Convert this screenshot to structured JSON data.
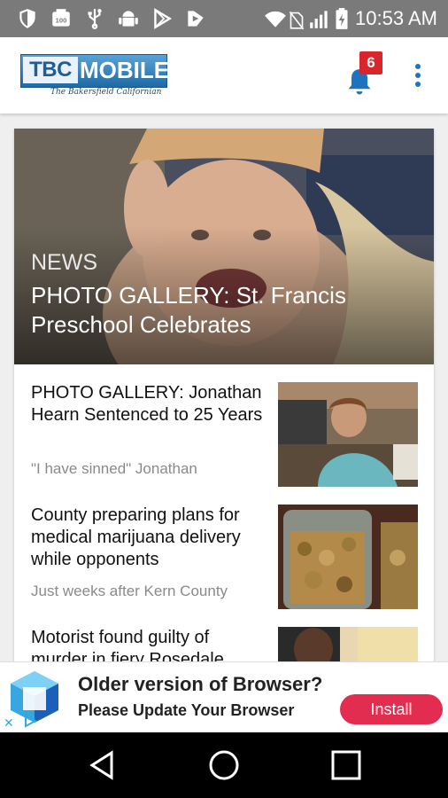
{
  "status_bar": {
    "time": "10:53 AM",
    "icons": [
      "shield-icon",
      "news-100-icon",
      "usb-icon",
      "android-icon",
      "play-store-icon",
      "play-movies-icon",
      "wifi-icon",
      "no-sim-icon",
      "signal-icon",
      "battery-icon"
    ]
  },
  "header": {
    "logo_tbc": "TBC",
    "logo_mobile": "MOBILE",
    "logo_subtitle": "The Bakersfield Californian",
    "notification_count": "6"
  },
  "hero": {
    "category": "NEWS",
    "title": "PHOTO GALLERY: St. Francis Preschool Celebrates"
  },
  "articles": [
    {
      "title": "PHOTO GALLERY: Jonathan Hearn Sentenced to 25 Years",
      "snippet": "\"I have sinned\" Jonathan"
    },
    {
      "title": "County preparing plans for medical marijuana delivery while opponents",
      "snippet": "Just weeks after Kern County"
    },
    {
      "title": "Motorist found guilty of murder in fiery Rosedale",
      "snippet": ""
    }
  ],
  "ad": {
    "title": "Older version of Browser?",
    "subtitle": "Please Update Your Browser",
    "install_label": "Install",
    "close_label": "✕",
    "accent": "#e32d50"
  },
  "colors": {
    "brand_blue": "#1e73be",
    "badge_red": "#d9262c",
    "status_bar": "#7a7a7a"
  }
}
